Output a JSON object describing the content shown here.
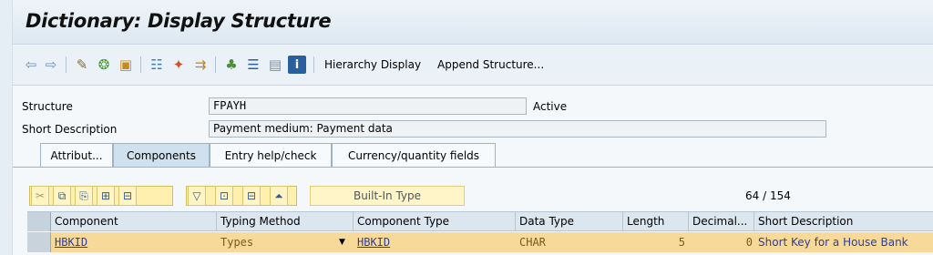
{
  "title": "Dictionary: Display Structure",
  "toolbar": {
    "icons": [
      "back-arrow-icon",
      "forward-arrow-icon",
      "display-change-icon",
      "activate-icon",
      "where-used-icon",
      "object-list-icon",
      "navigation-icon",
      "other-object-icon",
      "hierarchy-icon",
      "table-icon",
      "layout-icon",
      "info-icon"
    ],
    "hierarchy_display": "Hierarchy Display",
    "append_structure": "Append Structure..."
  },
  "form": {
    "structure_label": "Structure",
    "structure_value": "FPAYH",
    "status": "Active",
    "short_desc_label": "Short Description",
    "short_desc_value": "Payment medium: Payment data"
  },
  "tabs": [
    {
      "label": "Attribut...",
      "active": false
    },
    {
      "label": "Components",
      "active": true
    },
    {
      "label": "Entry help/check",
      "active": false
    },
    {
      "label": "Currency/quantity fields",
      "active": false
    }
  ],
  "table_toolbar": {
    "builtin_type": "Built-In Type",
    "counter_current": "64",
    "counter_sep": "/",
    "counter_total": "154"
  },
  "table": {
    "columns": [
      "Component",
      "Typing Method",
      "Component Type",
      "Data Type",
      "Length",
      "Decimal...",
      "Short Description"
    ],
    "rows": [
      {
        "component": "HBKID",
        "typing_method": "Types",
        "component_type": "HBKID",
        "data_type": "CHAR",
        "length": "5",
        "decimals": "0",
        "short_description": "Short Key for a House Bank"
      }
    ]
  }
}
